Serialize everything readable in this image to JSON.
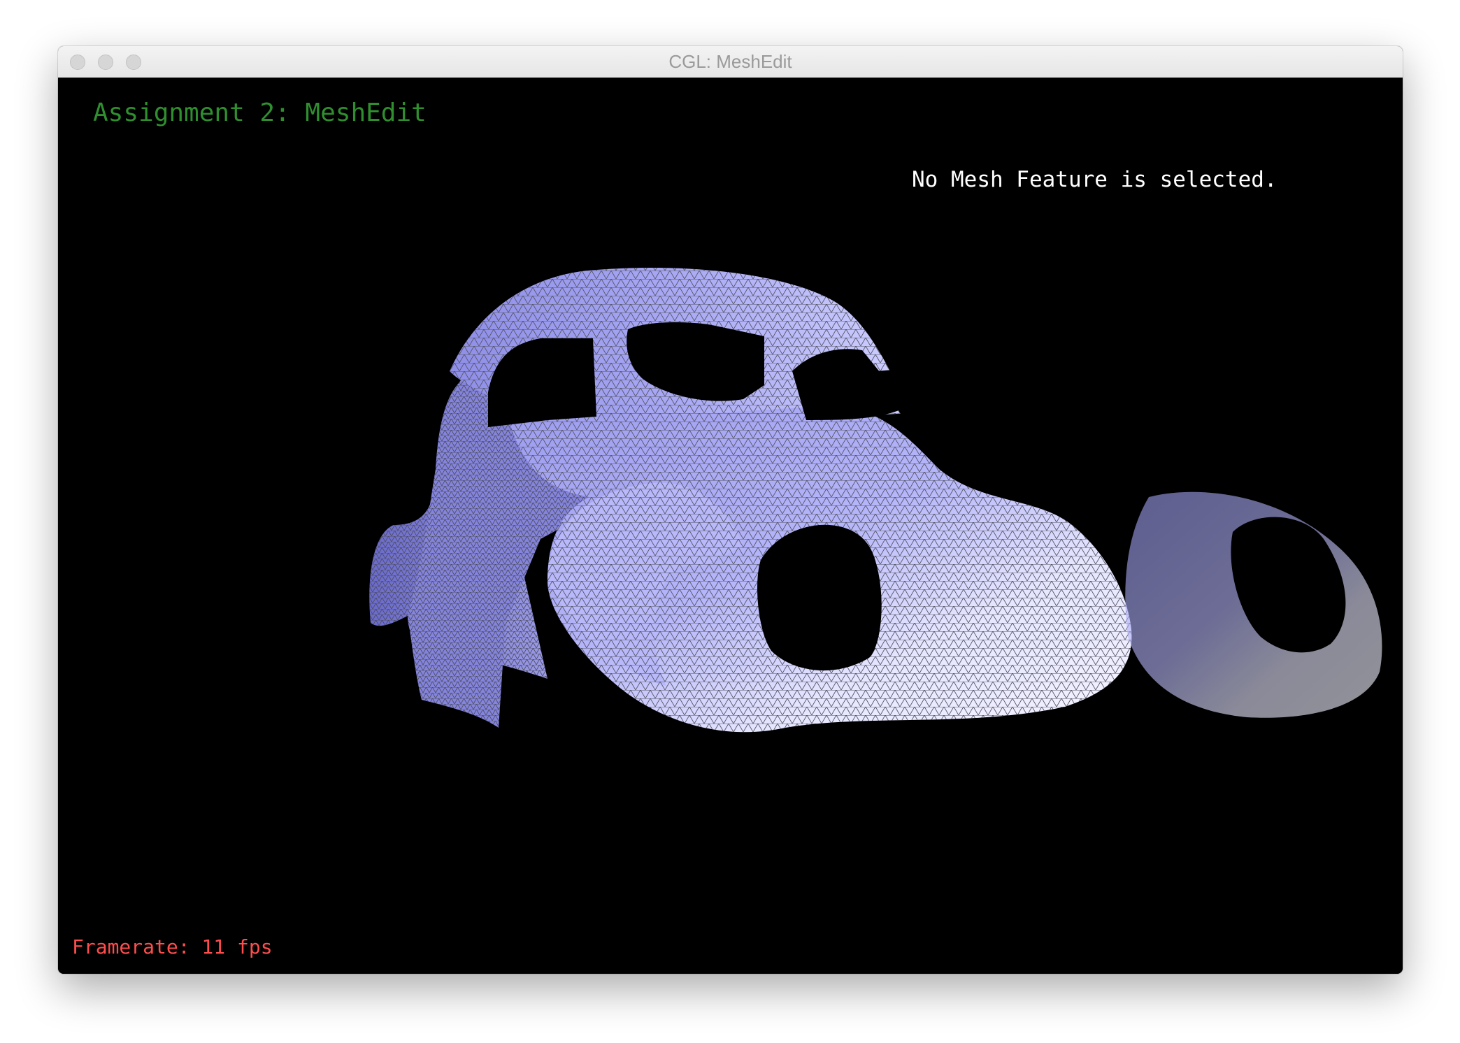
{
  "window": {
    "title": "CGL: MeshEdit",
    "controls": [
      "close-icon",
      "minimize-icon",
      "maximize-icon"
    ]
  },
  "viewport": {
    "heading": "Assignment 2: MeshEdit",
    "selection_status": "No Mesh Feature is selected.",
    "framerate": "Framerate: 11 fps",
    "model": "vw-beetle-car-body-mesh"
  },
  "colors": {
    "background": "#000000",
    "heading": "#2f8f2f",
    "status": "#ffffff",
    "framerate": "#ff4d4d",
    "mesh_fill": "#c9c9ff",
    "mesh_shadow": "#7a7adf",
    "mesh_wire": "#555566"
  }
}
